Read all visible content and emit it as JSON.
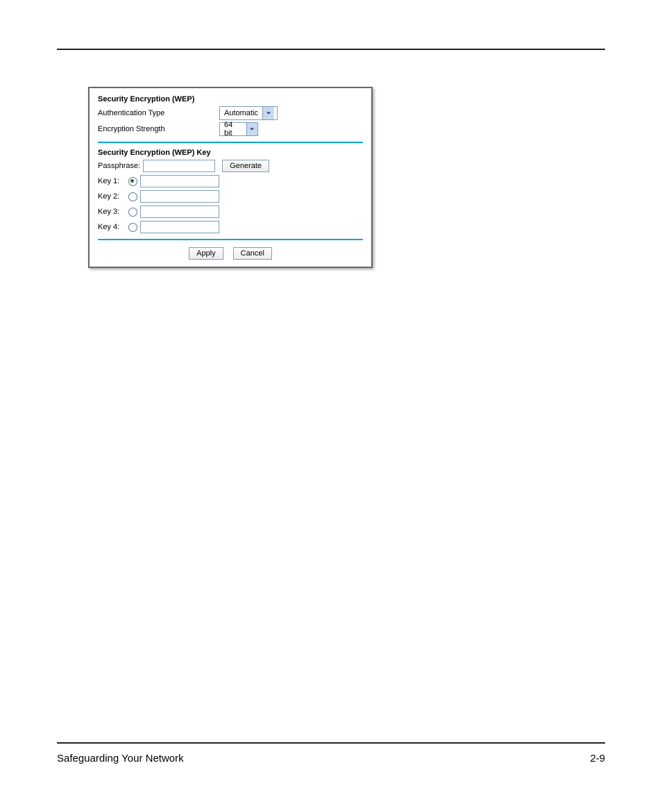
{
  "panel": {
    "section1_title": "Security Encryption (WEP)",
    "auth_label": "Authentication Type",
    "auth_value": "Automatic",
    "enc_label": "Encryption Strength",
    "enc_value": "64 bit",
    "section2_title": "Security Encryption (WEP) Key",
    "pass_label": "Passphrase:",
    "generate_label": "Generate",
    "keys": [
      {
        "label": "Key 1:",
        "selected": true
      },
      {
        "label": "Key 2:",
        "selected": false
      },
      {
        "label": "Key 3:",
        "selected": false
      },
      {
        "label": "Key 4:",
        "selected": false
      }
    ],
    "apply_label": "Apply",
    "cancel_label": "Cancel"
  },
  "footer": {
    "left": "Safeguarding Your Network",
    "right": "2-9"
  }
}
